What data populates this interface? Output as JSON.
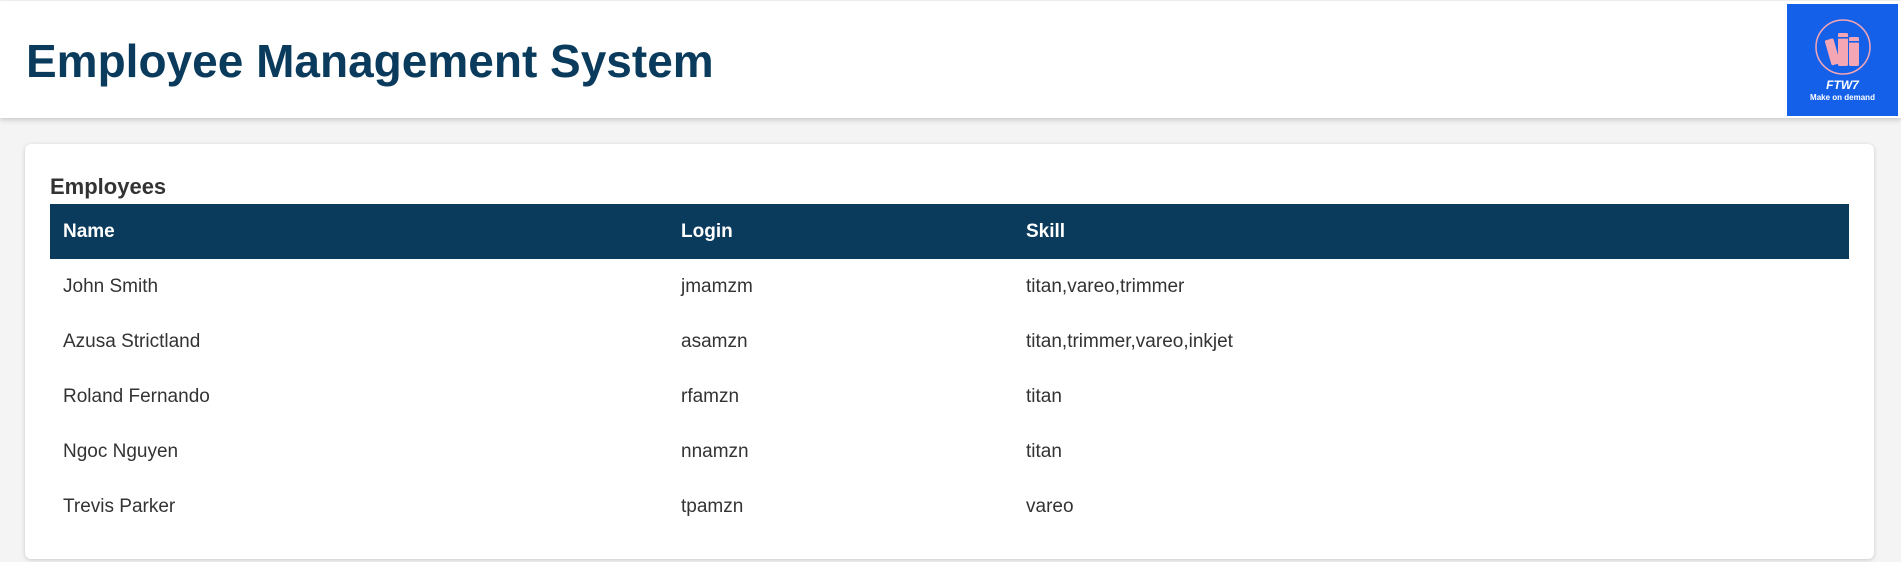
{
  "header": {
    "title": "Employee Management System",
    "logo": {
      "icon": "book-stack-icon",
      "name": "FTW7",
      "tagline": "Make on demand",
      "background_color": "#1560e8",
      "book_color": "#f4a6b4"
    },
    "title_color": "#0a3b5c"
  },
  "employees": {
    "heading": "Employees",
    "columns": {
      "name": "Name",
      "login": "Login",
      "skill": "Skill"
    },
    "header_color": "#0a3b5c",
    "rows": [
      {
        "name": "John Smith",
        "login": "jmamzm",
        "skill": "titan,vareo,trimmer"
      },
      {
        "name": "Azusa Strictland",
        "login": "asamzn",
        "skill": "titan,trimmer,vareo,inkjet"
      },
      {
        "name": "Roland Fernando",
        "login": "rfamzn",
        "skill": "titan"
      },
      {
        "name": "Ngoc Nguyen",
        "login": "nnamzn",
        "skill": "titan"
      },
      {
        "name": "Trevis Parker",
        "login": "tpamzn",
        "skill": "vareo"
      }
    ]
  }
}
